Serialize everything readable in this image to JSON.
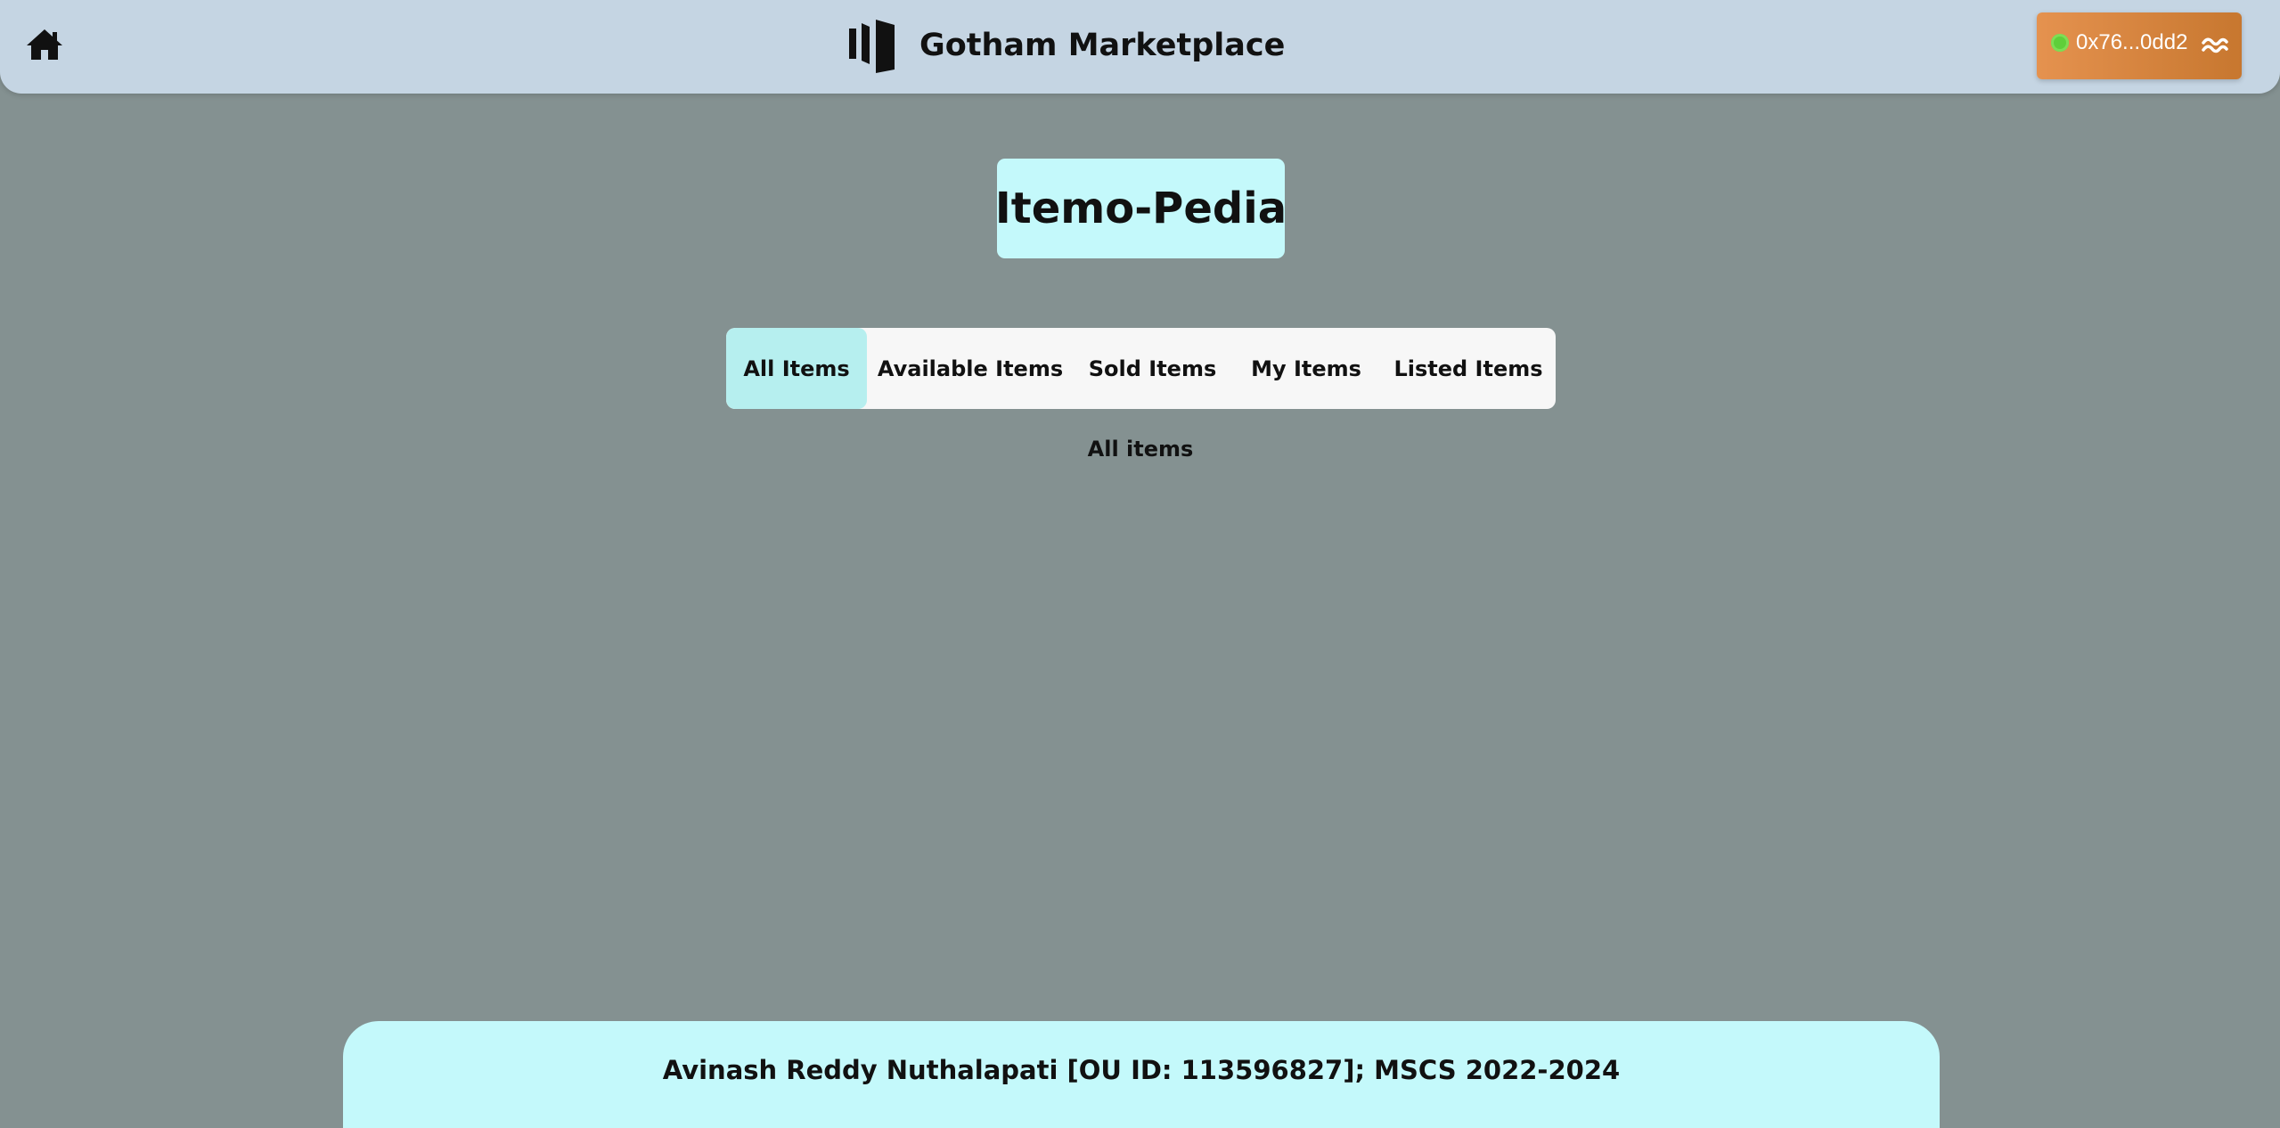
{
  "header": {
    "home_icon": "home-icon",
    "brand_logo_icon": "bars-logo-icon",
    "title": "Gotham Marketplace",
    "wallet": {
      "address": "0x76...0dd2",
      "status_color": "#5fcf3a",
      "network_icon": "wave-icon"
    }
  },
  "main": {
    "page_title": "Itemo-Pedia",
    "tabs": [
      {
        "label": "All Items",
        "active": true
      },
      {
        "label": "Available Items",
        "active": false
      },
      {
        "label": "Sold Items",
        "active": false
      },
      {
        "label": "My Items",
        "active": false
      },
      {
        "label": "Listed Items",
        "active": false
      }
    ],
    "section_label": "All items"
  },
  "footer": {
    "text": "Avinash Reddy Nuthalapati [OU ID: 113596827]; MSCS 2022-2024"
  },
  "colors": {
    "background": "#849191",
    "header": "#c5d5e3",
    "accent_box": "#c4f9fb",
    "active_tab": "#b6efef",
    "wallet_button": "#e5924f"
  }
}
